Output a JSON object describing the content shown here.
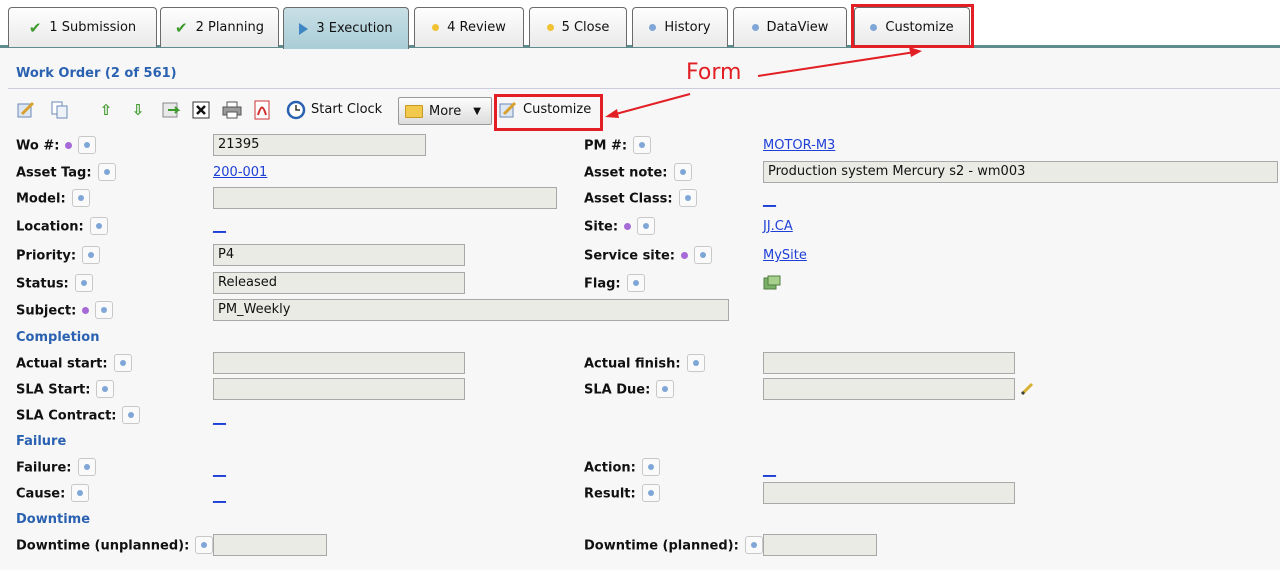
{
  "tabs": [
    {
      "label": "1 Submission",
      "icon": "check-icon"
    },
    {
      "label": "2 Planning",
      "icon": "check-icon"
    },
    {
      "label": "3 Execution",
      "icon": "play-icon"
    },
    {
      "label": "4 Review",
      "icon": "dot-icon"
    },
    {
      "label": "5 Close",
      "icon": "dot-icon"
    },
    {
      "label": "History",
      "icon": "dot-icon"
    },
    {
      "label": "DataView",
      "icon": "dot-icon"
    },
    {
      "label": "Customize",
      "icon": "dot-icon"
    }
  ],
  "colors": {
    "accent": "#2a62b1",
    "highlight": "#e11f25",
    "link": "#1e3fd6",
    "required_dot": "#a56ad6",
    "active_tab": "#a9cdd6",
    "tab_dot_yellow": "#f1c232",
    "tab_dot_blue": "#7fa6d7"
  },
  "header": {
    "title": "Work Order (2 of 561)"
  },
  "annotation": {
    "text": "Form"
  },
  "toolbar": {
    "start_clock": "Start Clock",
    "more": "More",
    "customize": "Customize"
  },
  "fields": {
    "wo": {
      "label": "Wo #:",
      "value": "21395"
    },
    "pm": {
      "label": "PM #:",
      "value": "MOTOR-M3"
    },
    "asset_tag": {
      "label": "Asset Tag:",
      "value": "200-001"
    },
    "asset_note": {
      "label": "Asset note:",
      "value": "Production system Mercury s2 - wm003"
    },
    "model": {
      "label": "Model:",
      "value": ""
    },
    "asset_class": {
      "label": "Asset Class:",
      "value": "__"
    },
    "location": {
      "label": "Location:",
      "value": "__"
    },
    "site": {
      "label": "Site:",
      "value": "JJ.CA"
    },
    "priority": {
      "label": "Priority:",
      "value": "P4"
    },
    "service_site": {
      "label": "Service site:",
      "value": "MySite"
    },
    "status": {
      "label": "Status:",
      "value": "Released"
    },
    "flag": {
      "label": "Flag:"
    },
    "subject": {
      "label": "Subject:",
      "value": "PM_Weekly"
    }
  },
  "sections": {
    "completion": {
      "title": "Completion",
      "actual_start": "Actual start:",
      "actual_finish": "Actual finish:",
      "sla_start": "SLA Start:",
      "sla_due": "SLA Due:",
      "sla_contract": "SLA Contract:",
      "sla_contract_value": "__"
    },
    "failure": {
      "title": "Failure",
      "failure": "Failure:",
      "failure_value": "__",
      "action": "Action:",
      "action_value": "__",
      "cause": "Cause:",
      "cause_value": "__",
      "result": "Result:"
    },
    "downtime": {
      "title": "Downtime",
      "unplanned": "Downtime (unplanned):",
      "planned": "Downtime (planned):"
    }
  }
}
